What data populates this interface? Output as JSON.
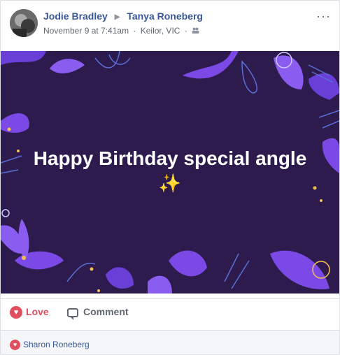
{
  "post": {
    "author": "Jodie Bradley",
    "target": "Tanya Roneberg",
    "date": "November 9 at 7:41am",
    "location": "Keilor, VIC",
    "separator": "·",
    "more_label": "···",
    "audience_icon": "friends-icon"
  },
  "media": {
    "headline": "Happy Birthday special angle",
    "sparkle": "✨",
    "colors": {
      "background": "#2d1b4e",
      "accent": "#6a3fd8",
      "highlight": "#f5c04e"
    }
  },
  "actions": {
    "love_label": "Love",
    "comment_label": "Comment",
    "love_color": "#e04f5f"
  },
  "reactions": {
    "reactor": "Sharon Roneberg"
  }
}
